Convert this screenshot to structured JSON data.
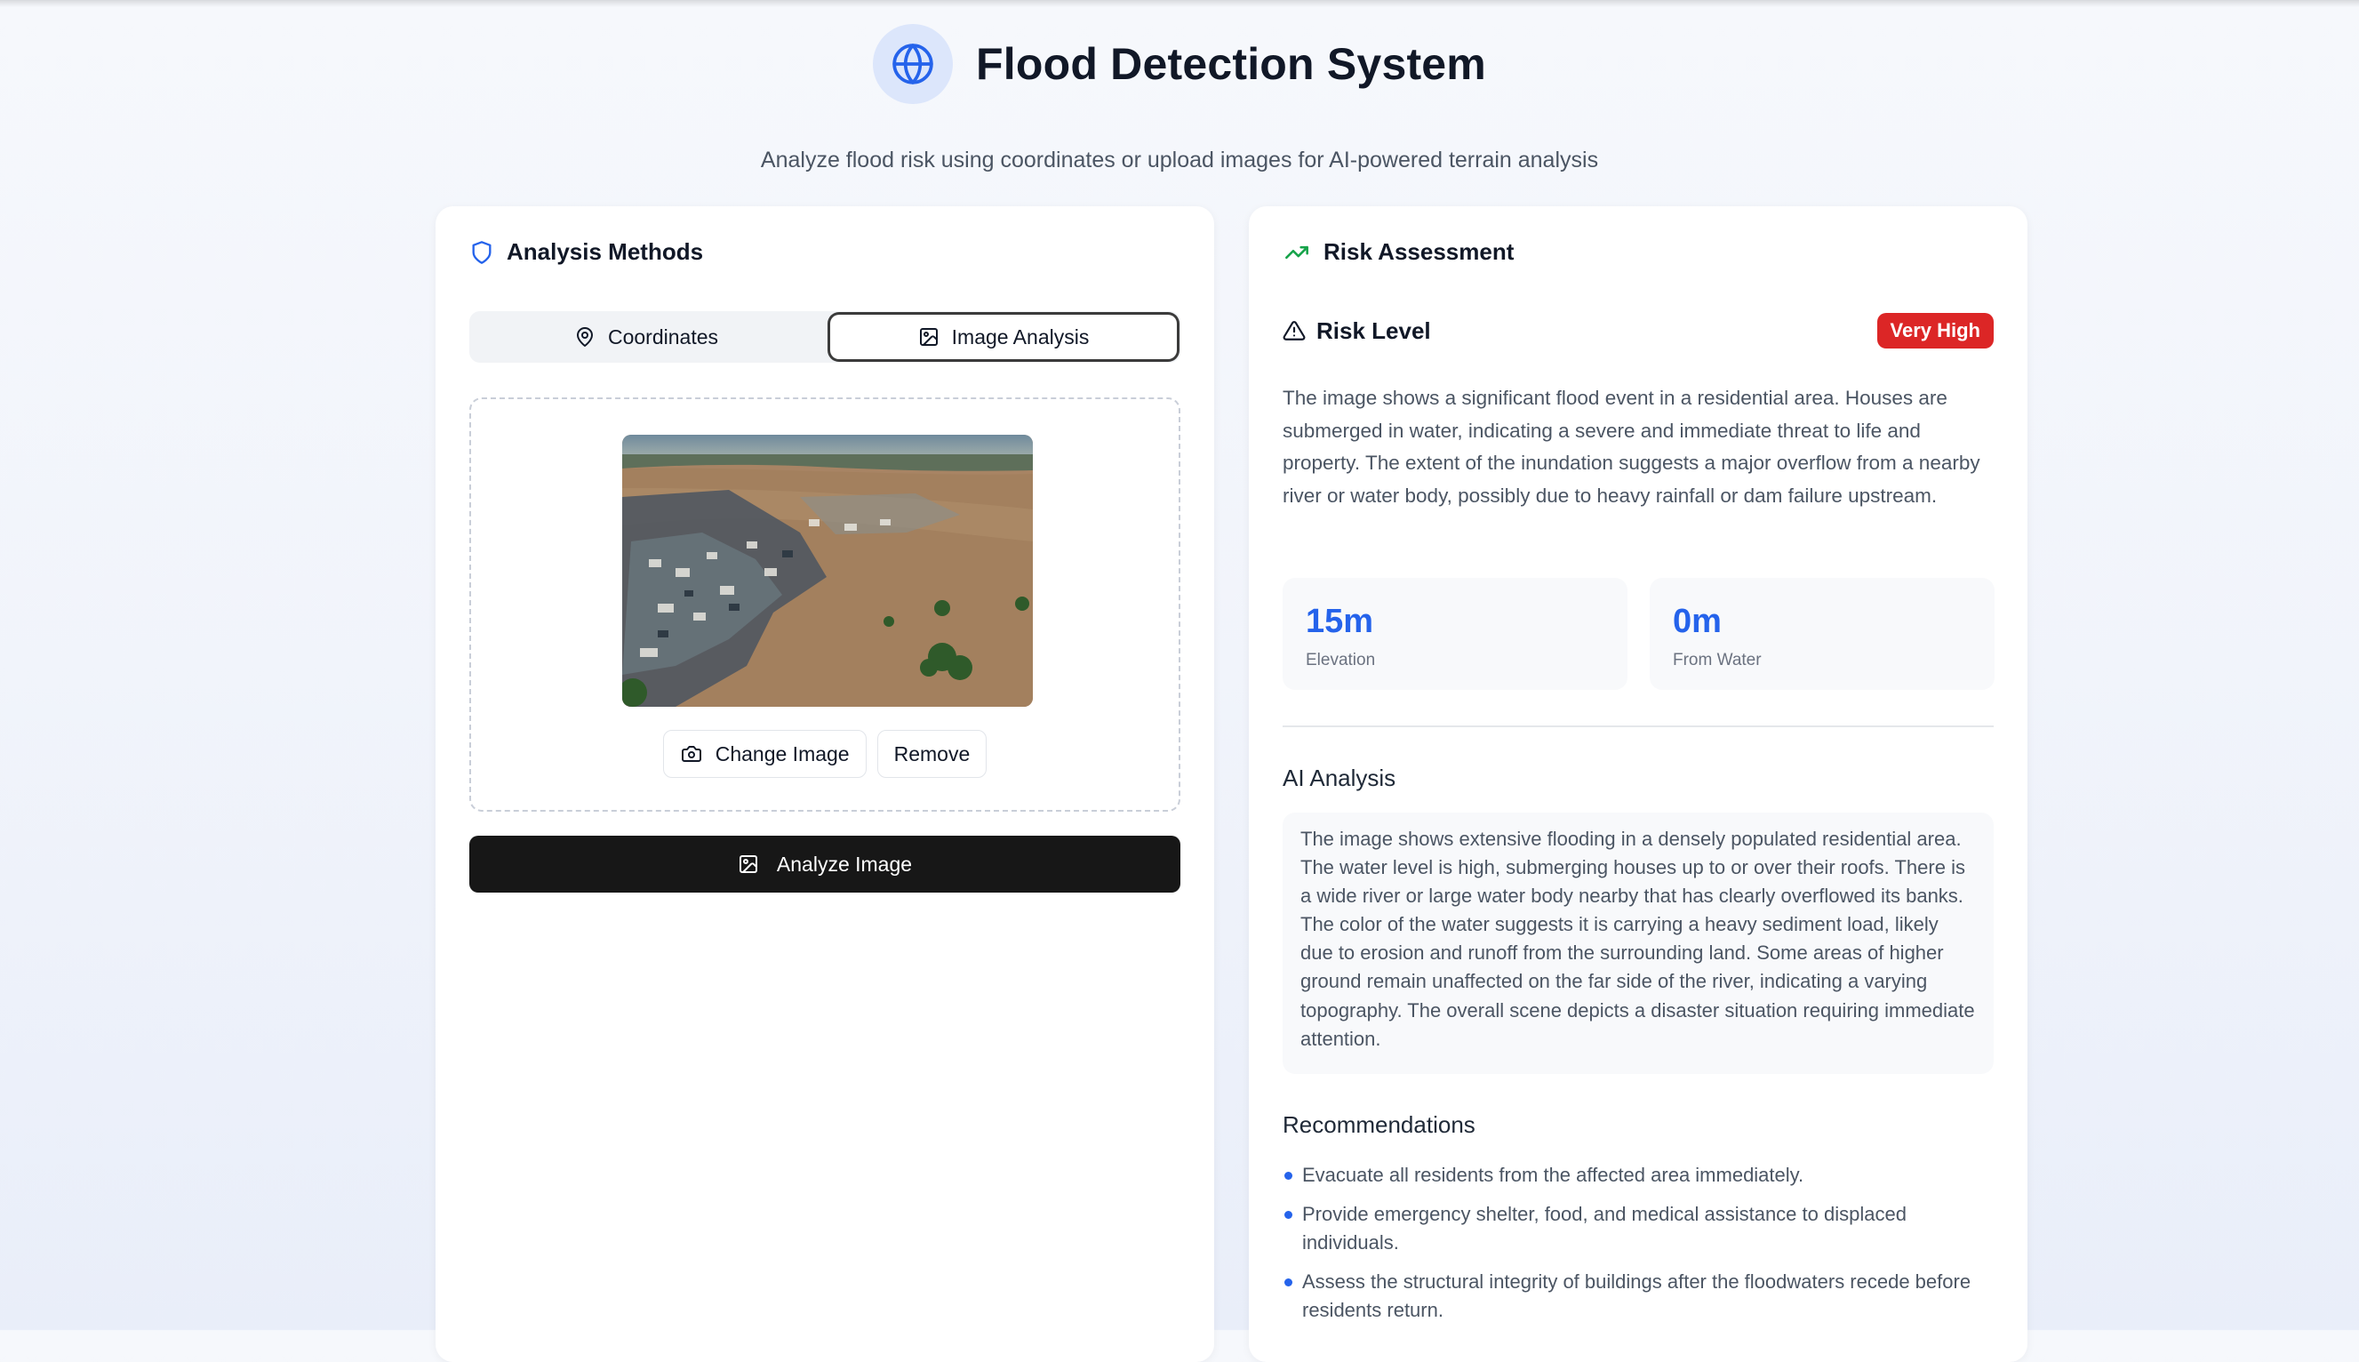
{
  "header": {
    "title": "Flood Detection System",
    "subtitle": "Analyze flood risk using coordinates or upload images for AI-powered terrain analysis",
    "icon": "globe-icon"
  },
  "colors": {
    "accent": "#2563eb",
    "danger": "#dc2626",
    "primary_button": "#171717",
    "trend": "#16a34a"
  },
  "analysis": {
    "title": "Analysis Methods",
    "icon": "shield-icon",
    "tabs": [
      {
        "label": "Coordinates",
        "icon": "map-pin-icon",
        "active": false
      },
      {
        "label": "Image Analysis",
        "icon": "image-icon",
        "active": true
      }
    ],
    "change_image_label": "Change Image",
    "remove_label": "Remove",
    "analyze_label": "Analyze Image"
  },
  "risk": {
    "title": "Risk Assessment",
    "icon": "trending-up-icon",
    "level_label": "Risk Level",
    "level_value": "Very High",
    "description": "The image shows a significant flood event in a residential area. Houses are submerged in water, indicating a severe and immediate threat to life and property. The extent of the inundation suggests a major overflow from a nearby river or water body, possibly due to heavy rainfall or dam failure upstream.",
    "stats": [
      {
        "value": "15m",
        "label": "Elevation"
      },
      {
        "value": "0m",
        "label": "From Water"
      }
    ],
    "ai_title": "AI Analysis",
    "ai_text": "The image shows extensive flooding in a densely populated residential area. The water level is high, submerging houses up to or over their roofs. There is a wide river or large water body nearby that has clearly overflowed its banks. The color of the water suggests it is carrying a heavy sediment load, likely due to erosion and runoff from the surrounding land. Some areas of higher ground remain unaffected on the far side of the river, indicating a varying topography. The overall scene depicts a disaster situation requiring immediate attention.",
    "recommendations_title": "Recommendations",
    "recommendations": [
      "Evacuate all residents from the affected area immediately.",
      "Provide emergency shelter, food, and medical assistance to displaced individuals.",
      "Assess the structural integrity of buildings after the floodwaters recede before residents return."
    ]
  }
}
